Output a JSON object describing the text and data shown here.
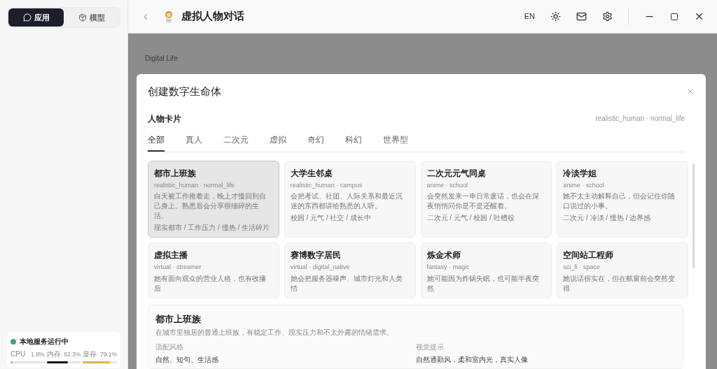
{
  "sidebar": {
    "modes": [
      {
        "label": "应用",
        "selected": true,
        "kind": "chat"
      },
      {
        "label": "模型",
        "selected": false,
        "kind": "box"
      }
    ],
    "status": {
      "label": "本地服务运行中",
      "color": "#3aa676",
      "meters": [
        {
          "name": "CPU",
          "reading": "1.8%",
          "level": 0.018,
          "color": "#9ca3af"
        },
        {
          "name": "内存",
          "reading": "62.3%",
          "level": 0.623,
          "color": "#111111"
        },
        {
          "name": "显存",
          "reading": "79.1%",
          "level": 0.791,
          "color": "#e0b341"
        }
      ]
    }
  },
  "header": {
    "title": "虚拟人物对话",
    "language": "EN"
  },
  "background": {
    "eyebrow": "Digital Life"
  },
  "dialog": {
    "title": "创建数字生命体",
    "section": "人物卡片",
    "current_type": "realistic_human · normal_life",
    "tabs": [
      {
        "label": "全部",
        "selected": true
      },
      {
        "label": "真人",
        "selected": false
      },
      {
        "label": "二次元",
        "selected": false
      },
      {
        "label": "虚拟",
        "selected": false
      },
      {
        "label": "奇幻",
        "selected": false
      },
      {
        "label": "科幻",
        "selected": false
      },
      {
        "label": "世界型",
        "selected": false
      }
    ],
    "cards": [
      {
        "name": "都市上班族",
        "type": "realistic_human · normal_life",
        "description": "白天被工作推着走，晚上才慢回到自己身上。熟悉后会分享很细碎的生活。",
        "tags": "现实都市 / 工作压力 / 慢热 / 生活碎片",
        "selected": true
      },
      {
        "name": "大学生邻桌",
        "type": "realistic_human · campus",
        "description": "会把考试、社团、人际关系和最近沉迷的东西都讲给熟悉的人听。",
        "tags": "校园 / 元气 / 社交 / 成长中",
        "selected": false
      },
      {
        "name": "二次元元气同桌",
        "type": "anime · school",
        "description": "会突然发来一串日常废话，也会在深夜悄悄问你是不是还醒着。",
        "tags": "二次元 / 元气 / 校园 / 吐槽役",
        "selected": false
      },
      {
        "name": "冷淡学姐",
        "type": "anime · school",
        "description": "她不太主动解释自己，但会记住你随口说过的小事。",
        "tags": "二次元 / 冷淡 / 慢热 / 边界感",
        "selected": false
      },
      {
        "name": "虚拟主播",
        "type": "virtual · streamer",
        "description": "她有面向观众的营业人格，也有收播后",
        "selected": false
      },
      {
        "name": "赛博数字居民",
        "type": "virtual · digital_native",
        "description": "她会把服务器噪声、城市灯光和人类情",
        "selected": false
      },
      {
        "name": "炼金术师",
        "type": "fantasy · magic",
        "description": "她可能因为炸锅失眠，也可能半夜突然",
        "selected": false
      },
      {
        "name": "空间站工程师",
        "type": "sci_fi · space",
        "description": "她说话很实在，但在舷窗前会突然变得",
        "selected": false
      }
    ],
    "detail": {
      "name": "都市上班族",
      "description": "在城市里独居的普通上班族，有稳定工作、现实压力和不太外露的情绪需求。",
      "fields": [
        {
          "label": "适配风格",
          "value": "自然、短句、生活感"
        },
        {
          "label": "视觉提示",
          "value": "自然通勤风，柔和室内光，真实人像"
        }
      ]
    }
  }
}
